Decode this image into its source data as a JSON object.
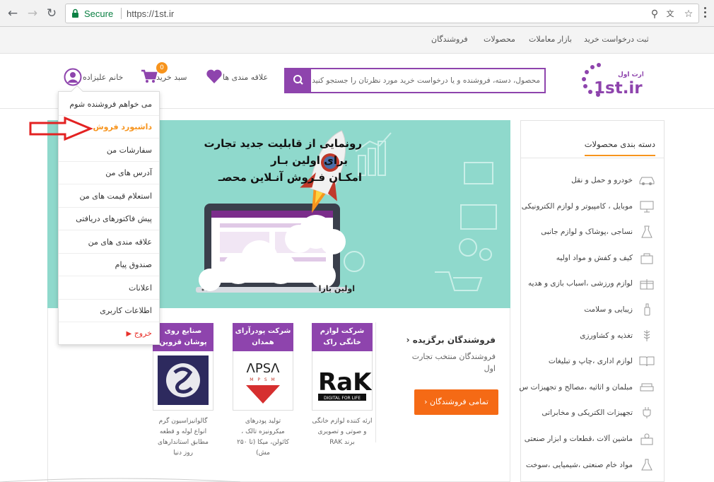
{
  "browser": {
    "secure_label": "Secure",
    "url": "https://1st.ir"
  },
  "topbar": {
    "links": [
      "ثبت درخواست خرید",
      "بازار معاملات",
      "محصولات",
      "فروشندگان"
    ]
  },
  "header": {
    "logo_text": "1st.ir",
    "logo_caption": "تجارت اول",
    "search_placeholder": "محصول، دسته، فروشنده و یا درخواست خرید مورد نظرتان را جستجو کنید",
    "wishlist_label": "علاقه مندی ها",
    "cart_label": "سبد خرید",
    "cart_count": "0",
    "user_label": "خانم علیزاده"
  },
  "dropdown": {
    "items": [
      "می خواهم فروشنده شوم",
      "داشبورد فروش",
      "سفارشات من",
      "آدرس های من",
      "استعلام قیمت های من",
      "پیش فاکتورهای دریافتی",
      "علاقه مندی های من",
      "صندوق پیام",
      "اعلانات",
      "اطلاعات کاربری",
      "خروج"
    ],
    "active_index": 1
  },
  "banner": {
    "line1": "رونمایی از قابلیت جدید تجارت",
    "line2": "برای اولین بـار",
    "line3": "امکـان فـروش آنـلاین محصـ",
    "footer_text": "اولین بازا"
  },
  "sidebar": {
    "title": "دسته بندی محصولات",
    "categories": [
      {
        "label": "خودرو و حمل و نقل",
        "icon": "car-icon"
      },
      {
        "label": "موبایل ، کامپیوتر و لوازم الکترونیکی",
        "icon": "monitor-icon"
      },
      {
        "label": "نساجی ،پوشاک و لوازم جانبی",
        "icon": "dress-icon"
      },
      {
        "label": "کیف و کفش و مواد اولیه",
        "icon": "bag-icon"
      },
      {
        "label": "لوازم ورزشی ،اسباب بازی و هدیه",
        "icon": "gift-icon"
      },
      {
        "label": "زیبایی و سلامت",
        "icon": "bottle-icon"
      },
      {
        "label": "تغذیه و کشاورزی",
        "icon": "wheat-icon"
      },
      {
        "label": "لوازم اداری ،چاپ و تبلیغات",
        "icon": "book-icon"
      },
      {
        "label": "مبلمان و اثاثیه ،مصالح و تجهیزات س",
        "icon": "sofa-icon"
      },
      {
        "label": "تجهیزات الکتریکی و مخابراتی",
        "icon": "plug-icon"
      },
      {
        "label": "ماشین آلات ،قطعات و ابزار صنعتی",
        "icon": "machine-icon"
      },
      {
        "label": "مواد خام صنعتی ،شیمیایی ،سوخت",
        "icon": "flask-icon"
      }
    ]
  },
  "featured": {
    "title": "فروشندگان برگزیده",
    "description": "فروشندگان منتخب تجارت اول",
    "all_button": "تمامی فروشندگان",
    "vendors": [
      {
        "name": "شرکت لوازم خانگی راک",
        "logo_text": "RaK",
        "logo_sub": "DIGITAL FOR LIFE",
        "desc": "ارئه کننده لوازم خانگی و صوتی و تصویری برند RAK"
      },
      {
        "name": "شرکت پودرآرای همدان",
        "logo_text": "ΛPSΛ",
        "logo_sub": "M P S M",
        "desc": "تولید پودرهای میکرونیزه تالک ، کائولن، میکا (تا ۲۵۰ مش)"
      },
      {
        "name": "صنایع روی پوشان قزوین",
        "logo_text": "",
        "logo_sub": "",
        "desc": "گالوانیزاسیون گرم انواع لوله و قطعه مطابق استاندارهای روز دنیا"
      }
    ]
  },
  "colors": {
    "purple": "#8e44ad",
    "orange": "#f7941d",
    "orange_button": "#f56a15",
    "banner_bg": "#8fd9cc",
    "logout_red": "#e8312b"
  }
}
